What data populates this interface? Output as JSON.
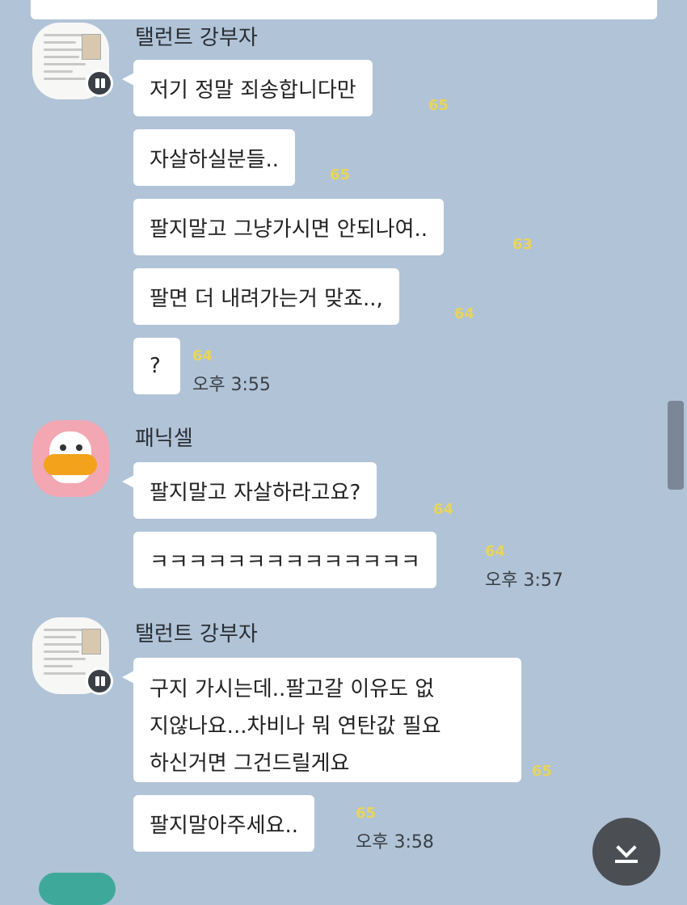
{
  "chat": {
    "group1": {
      "sender": "탤런트 강부자",
      "messages": [
        {
          "text": "저기 정말 죄송합니다만",
          "unread": "65"
        },
        {
          "text": "자살하실분들..",
          "unread": "65"
        },
        {
          "text": "팔지말고 그냥가시면 안되나여..",
          "unread": "63"
        },
        {
          "text": "팔면 더 내려가는거 맞죠..,",
          "unread": "64"
        },
        {
          "text": "?",
          "unread": "64",
          "time": "오후 3:55"
        }
      ]
    },
    "group2": {
      "sender": "패닉셀",
      "messages": [
        {
          "text": "팔지말고 자살하라고요?",
          "unread": "64"
        },
        {
          "text": "ㅋㅋㅋㅋㅋㅋㅋㅋㅋㅋㅋㅋㅋㅋ",
          "unread": "64",
          "time": "오후 3:57"
        }
      ]
    },
    "group3": {
      "sender": "탤런트 강부자",
      "messages": [
        {
          "lines": [
            "구지 가시는데..팔고갈 이유도 없",
            "지않나요...차비나 뭐 연탄값 필요",
            "하신거면 그건드릴게요"
          ],
          "unread": "65"
        },
        {
          "text": "팔지말아주세요..",
          "unread": "65",
          "time": "오후 3:58"
        }
      ]
    }
  },
  "icons": {
    "avatar1": "document-thumbnail-avatar",
    "avatar2": "duck-character-avatar",
    "badge": "pause-badge-icon",
    "scroll_down": "scroll-to-bottom-icon"
  },
  "colors": {
    "background": "#b1c3d7",
    "bubble": "#ffffff",
    "unread": "#e8d558"
  }
}
